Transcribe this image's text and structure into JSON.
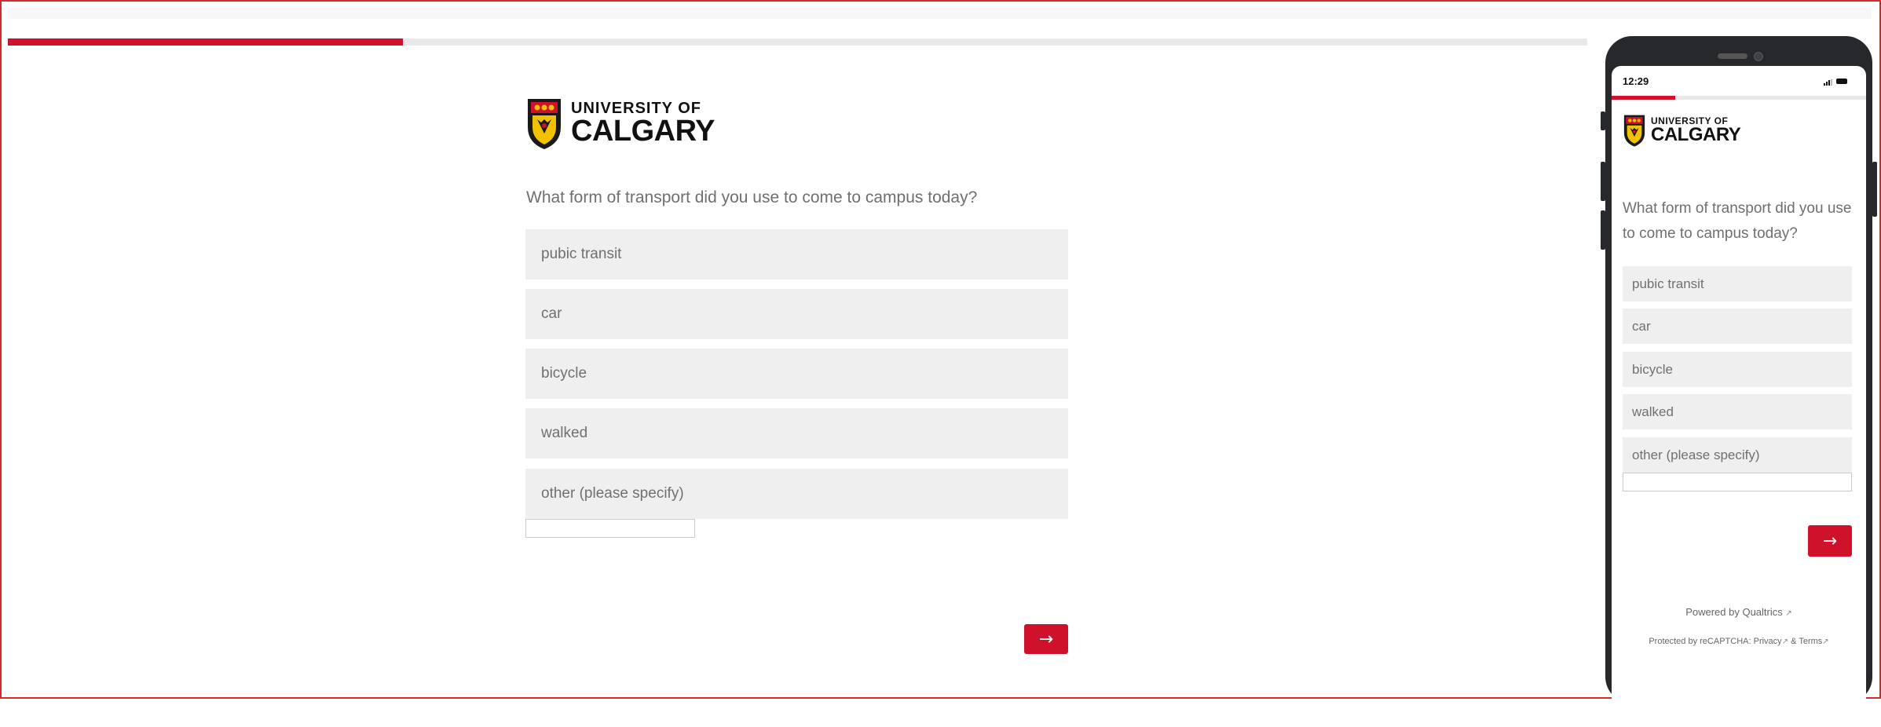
{
  "progress": {
    "fraction": 0.25
  },
  "brand": {
    "line1": "UNIVERSITY OF",
    "line2": "CALGARY"
  },
  "question": "What form of transport did you use to come to campus today?",
  "choices": [
    "pubic transit",
    "car",
    "bicycle",
    "walked",
    "other (please specify)"
  ],
  "next_label": "→",
  "mobile": {
    "time": "12:29",
    "progress": {
      "fraction": 0.25
    },
    "powered_by": "Powered by Qualtrics",
    "recaptcha_prefix": "Protected by reCAPTCHA:",
    "privacy": "Privacy",
    "amp": "&",
    "terms": "Terms"
  },
  "colors": {
    "accent": "#d0112b",
    "choice_bg": "#efefef",
    "text": "#707070",
    "frame": "#d42a2a"
  },
  "icons": {
    "next": "arrow-right-icon",
    "external": "external-link-icon",
    "crest": "university-crest-icon"
  }
}
